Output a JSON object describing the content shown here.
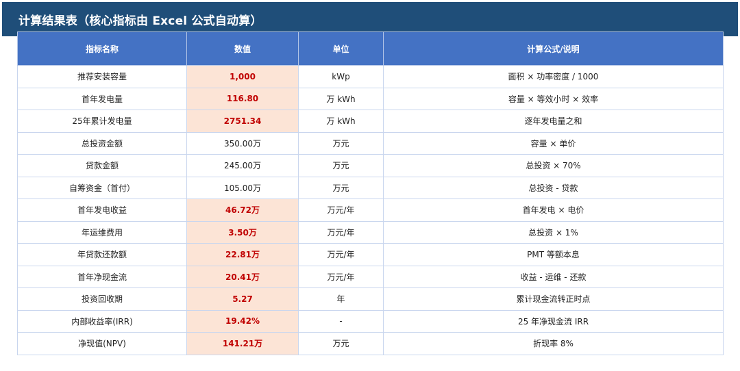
{
  "title": "计算结果表（核心指标由 Excel 公式自动算）",
  "headers": [
    "指标名称",
    "数值",
    "单位",
    "计算公式/说明"
  ],
  "rows": [
    {
      "name": "推荐安装容量",
      "value": "1,000",
      "unit": "kWp",
      "formula": "面积 × 功率密度 / 1000",
      "highlight": true
    },
    {
      "name": "首年发电量",
      "value": "116.80",
      "unit": "万 kWh",
      "formula": "容量 × 等效小时 × 效率",
      "highlight": true
    },
    {
      "name": "25年累计发电量",
      "value": "2751.34",
      "unit": "万 kWh",
      "formula": "逐年发电量之和",
      "highlight": true
    },
    {
      "name": "总投资金额",
      "value": "350.00万",
      "unit": "万元",
      "formula": "容量 × 单价",
      "highlight": false
    },
    {
      "name": "贷款金额",
      "value": "245.00万",
      "unit": "万元",
      "formula": "总投资 × 70%",
      "highlight": false
    },
    {
      "name": "自筹资金（首付）",
      "value": "105.00万",
      "unit": "万元",
      "formula": "总投资 - 贷款",
      "highlight": false
    },
    {
      "name": "首年发电收益",
      "value": "46.72万",
      "unit": "万元/年",
      "formula": "首年发电 × 电价",
      "highlight": true
    },
    {
      "name": "年运维费用",
      "value": "3.50万",
      "unit": "万元/年",
      "formula": "总投资 × 1%",
      "highlight": true
    },
    {
      "name": "年贷款还款额",
      "value": "22.81万",
      "unit": "万元/年",
      "formula": "PMT 等额本息",
      "highlight": true
    },
    {
      "name": "首年净现金流",
      "value": "20.41万",
      "unit": "万元/年",
      "formula": "收益 - 运维 - 还款",
      "highlight": true
    },
    {
      "name": "投资回收期",
      "value": "5.27",
      "unit": "年",
      "formula": "累计现金流转正时点",
      "highlight": true
    },
    {
      "name": "内部收益率(IRR)",
      "value": "19.42%",
      "unit": "-",
      "formula": "25 年净现金流 IRR",
      "highlight": true
    },
    {
      "name": "净现值(NPV)",
      "value": "141.21万",
      "unit": "万元",
      "formula": "折现率 8%",
      "highlight": true
    }
  ],
  "colors": {
    "title_bg": "#1f4e79",
    "header_bg": "#4472c4",
    "highlight_bg": "#fce4d6",
    "highlight_text": "#c00000"
  }
}
